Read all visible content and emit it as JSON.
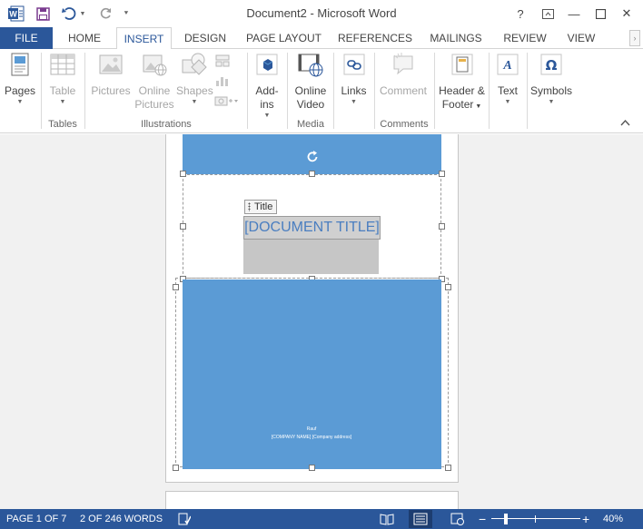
{
  "window": {
    "title": "Document2 - Microsoft Word",
    "help_label": "?",
    "minimize_label": "—",
    "close_label": "✕"
  },
  "tabs": [
    {
      "label": "FILE"
    },
    {
      "label": "HOME"
    },
    {
      "label": "INSERT"
    },
    {
      "label": "DESIGN"
    },
    {
      "label": "PAGE LAYOUT"
    },
    {
      "label": "REFERENCES"
    },
    {
      "label": "MAILINGS"
    },
    {
      "label": "REVIEW"
    },
    {
      "label": "VIEW"
    }
  ],
  "ribbon": {
    "pages": {
      "label": "Pages",
      "icon": "pages-icon"
    },
    "table": {
      "label": "Table",
      "icon": "table-icon"
    },
    "pictures": {
      "label": "Pictures",
      "icon": "pictures-icon"
    },
    "online_pictures": {
      "line1": "Online",
      "line2": "Pictures",
      "icon": "online-pictures-icon"
    },
    "shapes": {
      "label": "Shapes",
      "icon": "shapes-icon"
    },
    "addins": {
      "line1": "Add-",
      "line2": "ins",
      "icon": "addins-icon"
    },
    "online_video": {
      "line1": "Online",
      "line2": "Video",
      "icon": "online-video-icon"
    },
    "links": {
      "label": "Links",
      "icon": "links-icon"
    },
    "comment": {
      "label": "Comment",
      "icon": "comment-icon"
    },
    "header_footer": {
      "line1": "Header &",
      "line2": "Footer",
      "icon": "header-footer-icon"
    },
    "text": {
      "label": "Text",
      "icon": "text-icon"
    },
    "symbols": {
      "label": "Symbols",
      "icon": "omega-icon"
    },
    "groups": {
      "tables": "Tables",
      "illustrations": "Illustrations",
      "media": "Media",
      "comments": "Comments"
    }
  },
  "document": {
    "content_control_tag": "Title",
    "title_placeholder": "[DOCUMENT TITLE]",
    "author": "Rauf",
    "company_line": "[COMPANY NAME] [Company address]"
  },
  "status": {
    "page": "PAGE 1 OF 7",
    "words": "2 OF 246 WORDS",
    "zoom": "40%",
    "zoom_level_percent": 40
  },
  "colors": {
    "accent": "#2b579a",
    "cover_blue": "#5b9bd5"
  }
}
